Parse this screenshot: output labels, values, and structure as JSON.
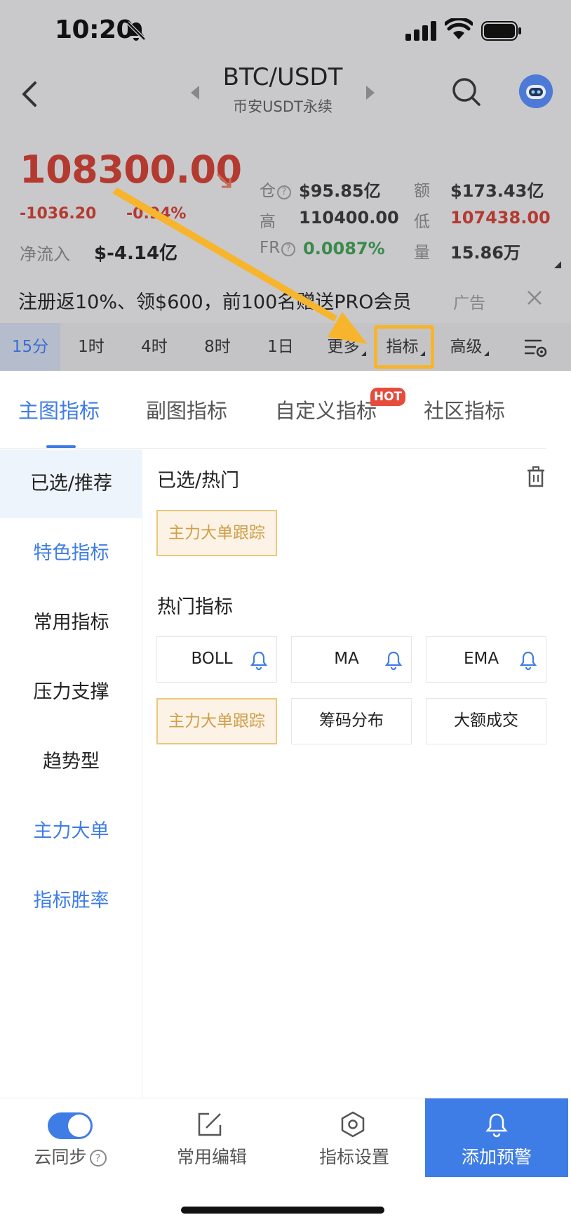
{
  "status_bar": {
    "time": "10:20"
  },
  "header": {
    "pair": "BTC/USDT",
    "exchange": "币安USDT永续"
  },
  "ticker": {
    "price": "108300.00",
    "change_abs": "-1036.20",
    "change_pct": "-0.94%",
    "net_inflow_label": "净流入",
    "net_inflow_value": "$-4.14亿",
    "stats": {
      "position_label": "仓",
      "position_value": "$95.85亿",
      "amount_label": "额",
      "amount_value": "$173.43亿",
      "high_label": "高",
      "high_value": "110400.00",
      "low_label": "低",
      "low_value": "107438.00",
      "fr_label": "FR",
      "fr_value": "0.0087%",
      "volume_label": "量",
      "volume_value": "15.86万"
    }
  },
  "ad": {
    "text": "注册返10%、领$600，前100名赠送PRO会员",
    "tag": "广告"
  },
  "timeframes": {
    "items": [
      "15分",
      "1时",
      "4时",
      "8时",
      "1日",
      "更多",
      "指标",
      "高级"
    ],
    "active_index": 0,
    "highlighted_index": 6
  },
  "colors": {
    "accent": "#3f7de6",
    "down": "#b43a30",
    "up": "#3a8a4a",
    "chip_selected": "#cf9f4a",
    "annotation": "#f7b52e"
  },
  "sheet": {
    "tabs": [
      "主图指标",
      "副图指标",
      "自定义指标",
      "社区指标"
    ],
    "active_tab": 0,
    "hot_badge": "HOT",
    "side_nav": [
      "已选/推荐",
      "特色指标",
      "常用指标",
      "压力支撑",
      "趋势型",
      "主力大单",
      "指标胜率"
    ],
    "selected_section_title": "已选/热门",
    "selected_chips": [
      "主力大单跟踪"
    ],
    "hot_section_title": "热门指标",
    "hot_chips": [
      "BOLL",
      "MA",
      "EMA",
      "主力大单跟踪",
      "筹码分布",
      "大额成交"
    ]
  },
  "bottom_bar": {
    "cloud_sync": "云同步",
    "cloud_sync_on": true,
    "common_edit": "常用编辑",
    "indicator_settings": "指标设置",
    "add_alert": "添加预警"
  },
  "icons": [
    "mute-bell-icon",
    "signal-icon",
    "wifi-icon",
    "battery-icon",
    "back-chevron-icon",
    "search-icon",
    "avatar-robot-icon",
    "trash-icon",
    "bell-icon",
    "edit-icon",
    "hexagon-settings-icon"
  ]
}
